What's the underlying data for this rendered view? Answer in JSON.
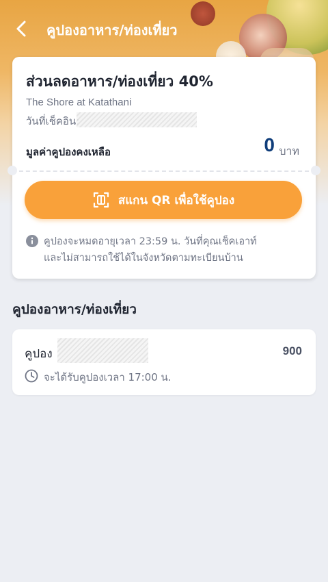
{
  "header": {
    "title": "คูปองอาหาร/ท่องเที่ยว",
    "back_icon": "chevron-left-icon"
  },
  "coupon_card": {
    "title": "ส่วนลดอาหาร/ท่องเที่ยว 40%",
    "hotel_name": "The Shore at Katathani",
    "checkin_label": "วันที่เช็คอิน:",
    "balance_label": "มูลค่าคูปองคงเหลือ",
    "balance_value": "0",
    "balance_unit": "บาท",
    "scan_button_label": "สแกน QR เพื่อใช้คูปอง",
    "scan_icon": "qr-scan-icon",
    "notice_line1": "คูปองจะหมดอายุเวลา 23:59 น. วันที่คุณเช็คเอาท์",
    "notice_line2": "และไม่สามารถใช้ได้ในจังหวัดตามทะเบียนบ้าน",
    "notice_icon": "info-icon"
  },
  "section": {
    "title": "คูปองอาหาร/ท่องเที่ยว"
  },
  "coupon_list": [
    {
      "label": "คูปอง",
      "amount": "900",
      "time_text": "จะได้รับคูปองเวลา 17:00 น.",
      "time_icon": "clock-icon"
    }
  ],
  "colors": {
    "accent": "#f9a13a",
    "balance": "#0f3d7a",
    "background": "#eceef3"
  }
}
